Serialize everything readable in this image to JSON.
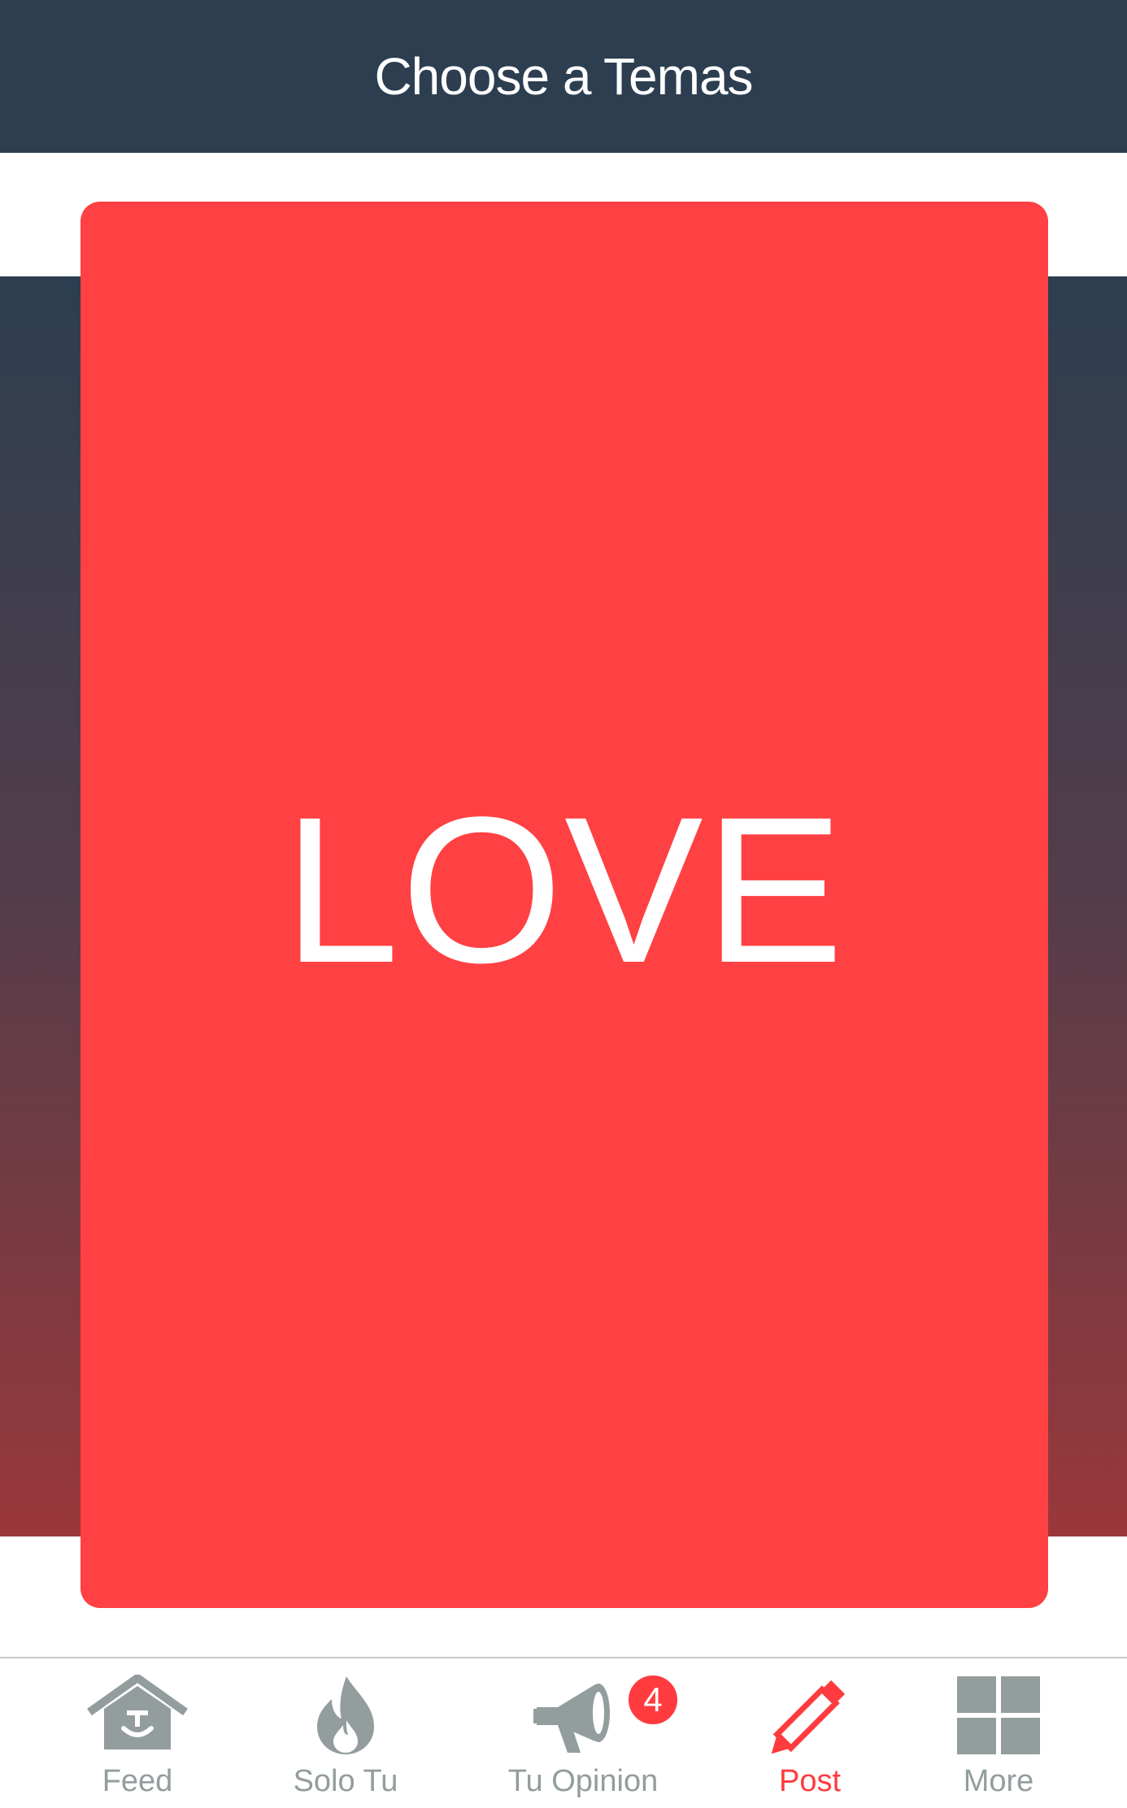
{
  "header": {
    "title": "Choose a Temas"
  },
  "card": {
    "label": "LOVE",
    "color": "#ff4143"
  },
  "tabbar": {
    "items": [
      {
        "label": "Feed",
        "icon": "feed-home-icon",
        "active": false
      },
      {
        "label": "Solo Tu",
        "icon": "flame-icon",
        "active": false
      },
      {
        "label": "Tu Opinion",
        "icon": "megaphone-icon",
        "active": false,
        "badge": "4"
      },
      {
        "label": "Post",
        "icon": "pencil-icon",
        "active": true
      },
      {
        "label": "More",
        "icon": "grid-icon",
        "active": false
      }
    ]
  },
  "colors": {
    "header_bg": "#2c3e50",
    "accent": "#ff3b3f",
    "inactive": "#939d9e"
  }
}
